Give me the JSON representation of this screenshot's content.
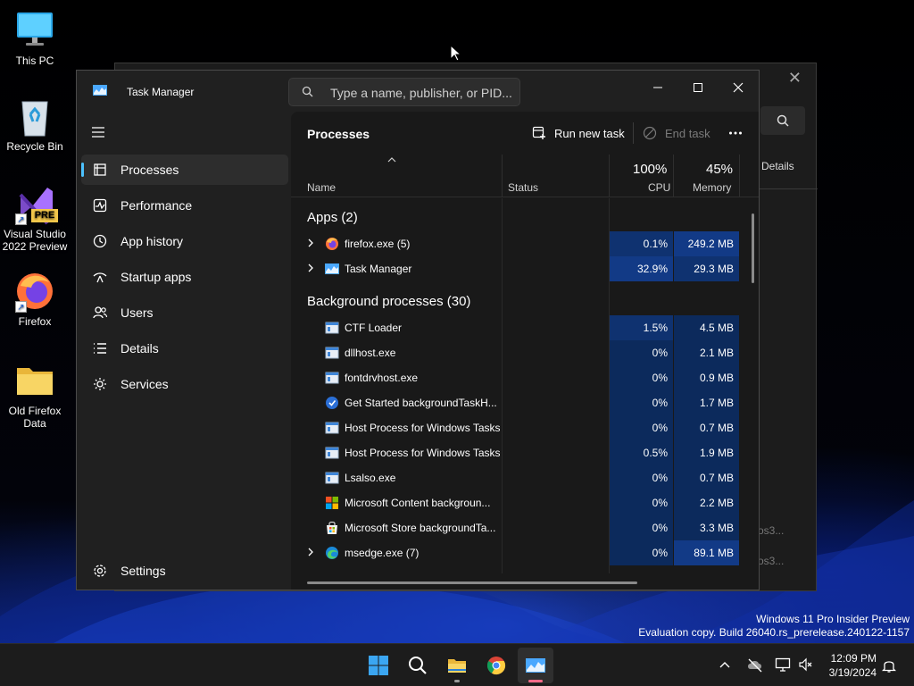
{
  "desktop": {
    "icons": [
      {
        "label": "This PC"
      },
      {
        "label": "Recycle Bin"
      },
      {
        "label": "Visual Studio 2022 Preview",
        "badge": "PRE"
      },
      {
        "label": "Firefox"
      },
      {
        "label": "Old Firefox Data"
      }
    ]
  },
  "background_window": {
    "details_label": "Details",
    "row_texts": [
      "os3...",
      "os3..."
    ]
  },
  "task_manager": {
    "title": "Task Manager",
    "search_placeholder": "Type a name, publisher, or PID...",
    "nav": [
      {
        "label": "Processes",
        "icon": "processes-icon",
        "active": true
      },
      {
        "label": "Performance",
        "icon": "performance-icon"
      },
      {
        "label": "App history",
        "icon": "app-history-icon"
      },
      {
        "label": "Startup apps",
        "icon": "startup-apps-icon"
      },
      {
        "label": "Users",
        "icon": "users-icon"
      },
      {
        "label": "Details",
        "icon": "details-icon"
      },
      {
        "label": "Services",
        "icon": "services-icon"
      }
    ],
    "settings_label": "Settings",
    "page_title": "Processes",
    "commands": {
      "run_new_task": "Run new task",
      "end_task": "End task"
    },
    "columns": {
      "name": "Name",
      "status": "Status",
      "cpu_pct": "100%",
      "cpu": "CPU",
      "memory_pct": "45%",
      "memory": "Memory"
    },
    "groups": {
      "apps": "Apps (2)",
      "background": "Background processes (30)"
    },
    "apps": [
      {
        "name": "firefox.exe (5)",
        "cpu": "0.1%",
        "memory": "249.2 MB",
        "icon": "firefox-icon"
      },
      {
        "name": "Task Manager",
        "cpu": "32.9%",
        "memory": "29.3 MB",
        "icon": "task-manager-icon"
      }
    ],
    "background": [
      {
        "name": "CTF Loader",
        "cpu": "1.5%",
        "memory": "4.5 MB",
        "icon": "process-window-icon"
      },
      {
        "name": "dllhost.exe",
        "cpu": "0%",
        "memory": "2.1 MB",
        "icon": "process-window-icon"
      },
      {
        "name": "fontdrvhost.exe",
        "cpu": "0%",
        "memory": "0.9 MB",
        "icon": "process-window-icon"
      },
      {
        "name": "Get Started backgroundTaskH...",
        "cpu": "0%",
        "memory": "1.7 MB",
        "icon": "get-started-icon"
      },
      {
        "name": "Host Process for Windows Tasks",
        "cpu": "0%",
        "memory": "0.7 MB",
        "icon": "process-window-icon"
      },
      {
        "name": "Host Process for Windows Tasks",
        "cpu": "0.5%",
        "memory": "1.9 MB",
        "icon": "process-window-icon"
      },
      {
        "name": "Lsalso.exe",
        "cpu": "0%",
        "memory": "0.7 MB",
        "icon": "process-window-icon"
      },
      {
        "name": "Microsoft Content backgroun...",
        "cpu": "0%",
        "memory": "2.2 MB",
        "icon": "microsoft-logo-icon"
      },
      {
        "name": "Microsoft Store backgroundTa...",
        "cpu": "0%",
        "memory": "3.3 MB",
        "icon": "store-icon"
      },
      {
        "name": "msedge.exe (7)",
        "cpu": "0%",
        "memory": "89.1 MB",
        "icon": "edge-icon"
      }
    ]
  },
  "watermark": {
    "line1": "Windows 11 Pro Insider Preview",
    "line2": "Evaluation copy. Build 26040.rs_prerelease.240122-1157"
  },
  "taskbar": {
    "time": "12:09 PM",
    "date": "3/19/2024"
  },
  "colors": {
    "accent": "#4cc2ff",
    "heat_low": "#0c2a5c",
    "heat_mid": "#0f3270",
    "heat_high": "#123a86"
  }
}
